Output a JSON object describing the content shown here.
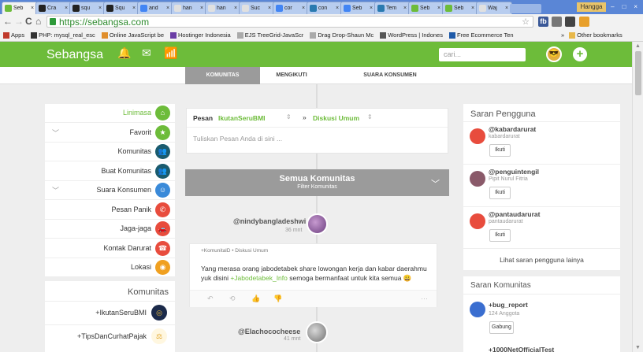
{
  "browser": {
    "tabs": [
      {
        "label": "Seb",
        "color": "#6dbc3a"
      },
      {
        "label": "Cra",
        "color": "#222222"
      },
      {
        "label": "squ",
        "color": "#222222"
      },
      {
        "label": "Squ",
        "color": "#222222"
      },
      {
        "label": "and",
        "color": "#4285f4"
      },
      {
        "label": "han",
        "color": "#e0e0e0"
      },
      {
        "label": "han",
        "color": "#e0e0e0"
      },
      {
        "label": "Suc",
        "color": "#e0e0e0"
      },
      {
        "label": "cor",
        "color": "#4285f4"
      },
      {
        "label": "con",
        "color": "#2a7ab0"
      },
      {
        "label": "Seb",
        "color": "#4285f4"
      },
      {
        "label": "Tem",
        "color": "#2a7ab0"
      },
      {
        "label": "Seb",
        "color": "#6dbc3a"
      },
      {
        "label": "Seb",
        "color": "#6dbc3a"
      },
      {
        "label": "Waj",
        "color": "#e0e0e0"
      }
    ],
    "tab_close": "×",
    "window_user": "Hangga",
    "win_min": "–",
    "win_max": "□",
    "win_close": "×",
    "back": "←",
    "forward": "→",
    "reload": "C",
    "home": "⌂",
    "url": "https://sebangsa.com",
    "star": "☆",
    "ext_fb": "fb",
    "bookmarks": [
      {
        "label": "Apps",
        "color": "#c0392b"
      },
      {
        "label": "PHP: mysql_real_esc",
        "color": "#333333"
      },
      {
        "label": "Online JavaScript be",
        "color": "#e08e2b"
      },
      {
        "label": "Hostinger Indonesia",
        "color": "#6a3da5"
      },
      {
        "label": "EJS TreeGrid-JavaScr",
        "color": "#aaaaaa"
      },
      {
        "label": "Drag Drop-Shaun Mc",
        "color": "#aaaaaa"
      },
      {
        "label": "WordPress | Indones",
        "color": "#555555"
      },
      {
        "label": "Free Ecommerce Ten",
        "color": "#1e5aa8"
      }
    ],
    "bm_more": "»",
    "other_bookmarks": "Other bookmarks"
  },
  "header": {
    "logo": "Sebangsa",
    "bell_icon": "🔔",
    "mail_icon": "✉",
    "stats_icon": "📶",
    "search_placeholder": "cari...",
    "avatar_glyph": "😎",
    "plus": "+"
  },
  "subnav": {
    "tabs": [
      "KOMUNITAS",
      "MENGIKUTI",
      "SUARA KONSUMEN"
    ]
  },
  "left_menu": {
    "items": [
      {
        "label": "Linimasa",
        "color": "#6dbc3a",
        "glyph": "⌂",
        "active": true
      },
      {
        "label": "Favorit",
        "color": "#6dbc3a",
        "glyph": "★",
        "chevron": "﹀"
      },
      {
        "label": "Komunitas",
        "color": "#1a5b6e",
        "glyph": "👥"
      },
      {
        "label": "Buat Komunitas",
        "color": "#1a5b6e",
        "glyph": "👥"
      },
      {
        "label": "Suara Konsumen",
        "color": "#3a8ad9",
        "glyph": "☺",
        "chevron": "﹀"
      },
      {
        "label": "Pesan Panik",
        "color": "#e84c3d",
        "glyph": "✆"
      },
      {
        "label": "Jaga-jaga",
        "color": "#e84c3d",
        "glyph": "🚗"
      },
      {
        "label": "Kontak Darurat",
        "color": "#e84c3d",
        "glyph": "☎"
      },
      {
        "label": "Lokasi",
        "color": "#f0a020",
        "glyph": "◉"
      }
    ],
    "communities_title": "Komunitas",
    "communities": [
      {
        "label": "+IkutanSeruBMI",
        "glyph": "◎",
        "bg": "#1b2a4a"
      },
      {
        "label": "+TipsDanCurhatPajak",
        "glyph": "⚖",
        "bg": "#fff7e0"
      }
    ]
  },
  "composer": {
    "pesan_label": "Pesan",
    "pesan_value": "IkutanSeruBMI",
    "sort_icon": "⇕",
    "separator": "»",
    "topic_value": "Diskusi Umum",
    "placeholder": "Tuliskan Pesan Anda di sini ..."
  },
  "feed": {
    "header_title": "Semua Komunitas",
    "header_sub": "Filter Komunitas",
    "chevron": "﹀",
    "post": {
      "user": "@nindybangladeshwi",
      "time": "36 mnt",
      "meta": "+KomunitalD • Diskusi Umum",
      "body_pre": "Yang merasa orang jabodetabek share lowongan kerja dan kabar daerahmu yuk disini ",
      "body_link": "+Jabodetabek_Info",
      "body_post": " semoga bermanfaat untuk kita semua",
      "emoji": "😀",
      "act_reply": "↶",
      "act_repost": "⟲",
      "act_like": "👍",
      "act_dislike": "👎",
      "act_more": "···"
    },
    "post2": {
      "user": "@Elachococheese",
      "time": "41 mnt"
    }
  },
  "suggestions": {
    "title": "Saran Pengguna",
    "users": [
      {
        "name": "@kabardarurat",
        "username": "kabardarurat",
        "button": "Ikuti",
        "color": "#e84c3d"
      },
      {
        "name": "@penguintengil",
        "username": "Pipit Nurul Fitria",
        "button": "Ikuti",
        "color": "#8a5a6a"
      },
      {
        "name": "@pantaudarurat",
        "username": "pantaudarurat",
        "button": "Ikuti",
        "color": "#e84c3d"
      }
    ],
    "more": "Lihat saran pengguna lainya"
  },
  "community_suggestions": {
    "title": "Saran Komunitas",
    "items": [
      {
        "name": "+bug_report",
        "count": "124 Anggota",
        "button": "Gabung"
      }
    ],
    "next_partial": "+1000NetOfficialTest"
  }
}
